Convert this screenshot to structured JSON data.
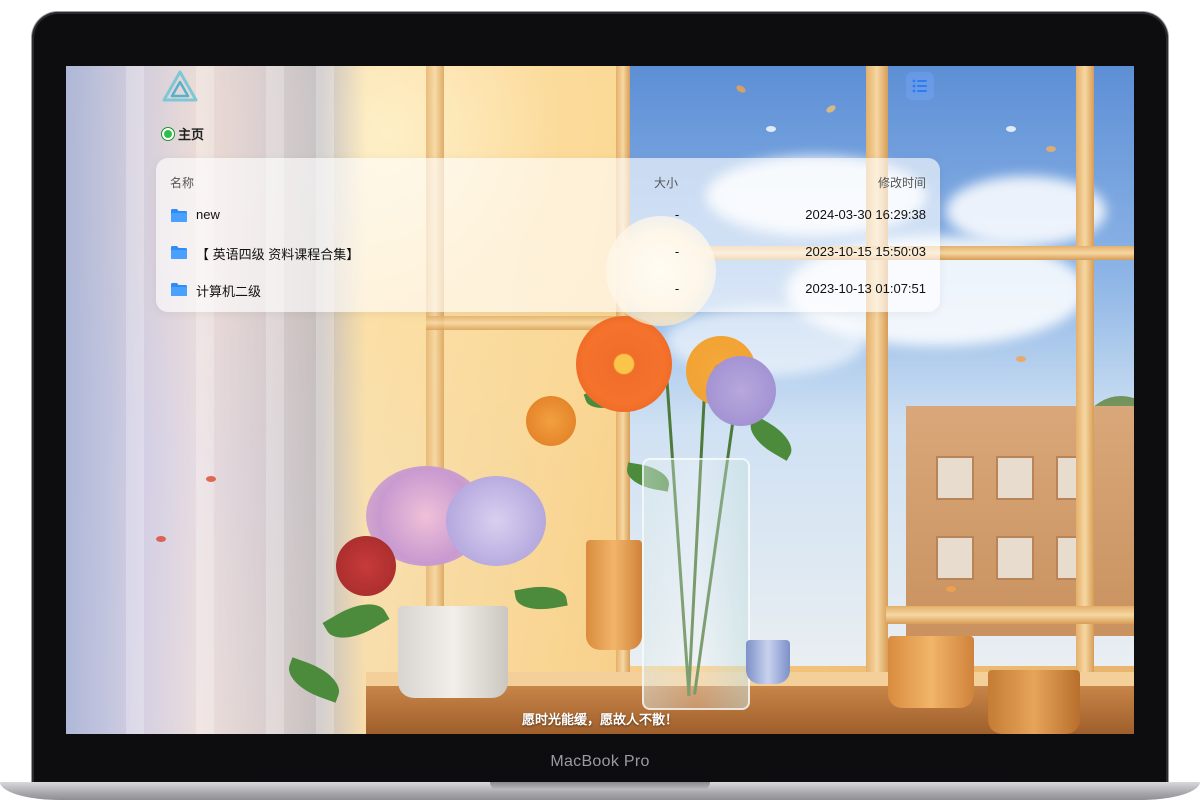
{
  "device": {
    "model_label": "MacBook Pro"
  },
  "app": {
    "logo_icon": "triangle-logo-icon",
    "list_toggle_icon": "list-icon"
  },
  "breadcrumb": {
    "home_label": "主页"
  },
  "file_list": {
    "columns": {
      "name": "名称",
      "size": "大小",
      "modified": "修改时间"
    },
    "rows": [
      {
        "name": "new",
        "size": "-",
        "modified": "2024-03-30 16:29:38"
      },
      {
        "name": "【 英语四级 资料课程合集】",
        "size": "-",
        "modified": "2023-10-15 15:50:03"
      },
      {
        "name": "计算机二级",
        "size": "-",
        "modified": "2023-10-13 01:07:51"
      }
    ]
  },
  "footer": {
    "quote": "愿时光能缓，愿故人不散！"
  },
  "colors": {
    "folder": "#2f8cf4",
    "accent": "#2fbf4a"
  }
}
